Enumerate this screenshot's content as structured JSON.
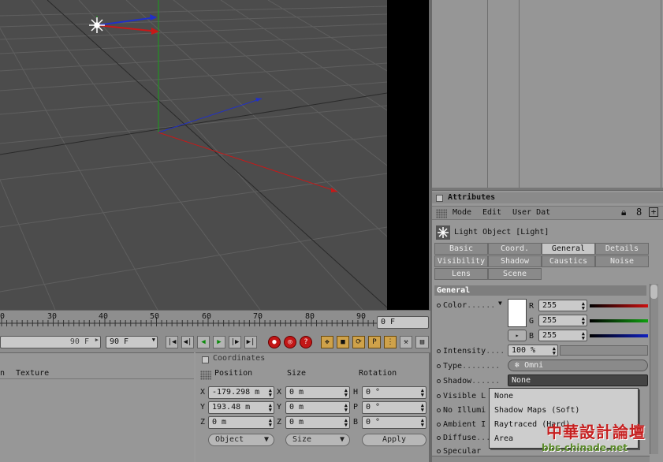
{
  "timeline": {
    "ticks": [
      "0",
      "30",
      "40",
      "50",
      "60",
      "70",
      "80",
      "90"
    ],
    "current_time": "0 F",
    "end_frame": "90 F",
    "max_frame": "90 F"
  },
  "object_manager": {
    "col_n": "n",
    "col_texture": "Texture"
  },
  "coordinates": {
    "title": "Coordinates",
    "headers": {
      "position": "Position",
      "size": "Size",
      "rotation": "Rotation"
    },
    "rows": [
      {
        "axis": "X",
        "pos": "-179.298 m",
        "size_axis": "X",
        "size": "0 m",
        "rot_axis": "H",
        "rot": "0 °"
      },
      {
        "axis": "Y",
        "pos": "193.48 m",
        "size_axis": "Y",
        "size": "0 m",
        "rot_axis": "P",
        "rot": "0 °"
      },
      {
        "axis": "Z",
        "pos": "0 m",
        "size_axis": "Z",
        "size": "0 m",
        "rot_axis": "B",
        "rot": "0 °"
      }
    ],
    "mode_dropdown": "Object",
    "size_dropdown": "Size",
    "apply_label": "Apply"
  },
  "attributes": {
    "title": "Attributes",
    "menu": [
      "Mode",
      "Edit",
      "User Dat"
    ],
    "object_name": "Light Object [Light]",
    "tabs_row1": [
      "Basic",
      "Coord.",
      "General",
      "Details"
    ],
    "tabs_row2": [
      "Visibility",
      "Shadow",
      "Caustics",
      "Noise"
    ],
    "tabs_row3": [
      "Lens",
      "Scene"
    ],
    "active_tab": "General",
    "section": "General",
    "color_label": "Color",
    "r_label": "R",
    "r_value": "255",
    "g_label": "G",
    "g_value": "255",
    "b_label": "B",
    "b_value": "255",
    "intensity_label": "Intensity",
    "intensity_value": "100 %",
    "type_label": "Type",
    "type_value": "Omni",
    "shadow_label": "Shadow",
    "shadow_value": "None",
    "visible_label": "Visible L",
    "no_illum_label": "No Illumi",
    "ambient_label": "Ambient I",
    "diffuse_label": "Diffuse",
    "specular_label": "Specular",
    "colors": {
      "red": "#cc1010",
      "green": "#10a010",
      "blue": "#1020c0"
    }
  },
  "shadow_popup": {
    "options": [
      "None",
      "Shadow Maps (Soft)",
      "Raytraced (Hard)",
      "Area"
    ]
  },
  "watermark": {
    "line1": "中華設計論壇",
    "line2": "bbs.chinade.net"
  }
}
